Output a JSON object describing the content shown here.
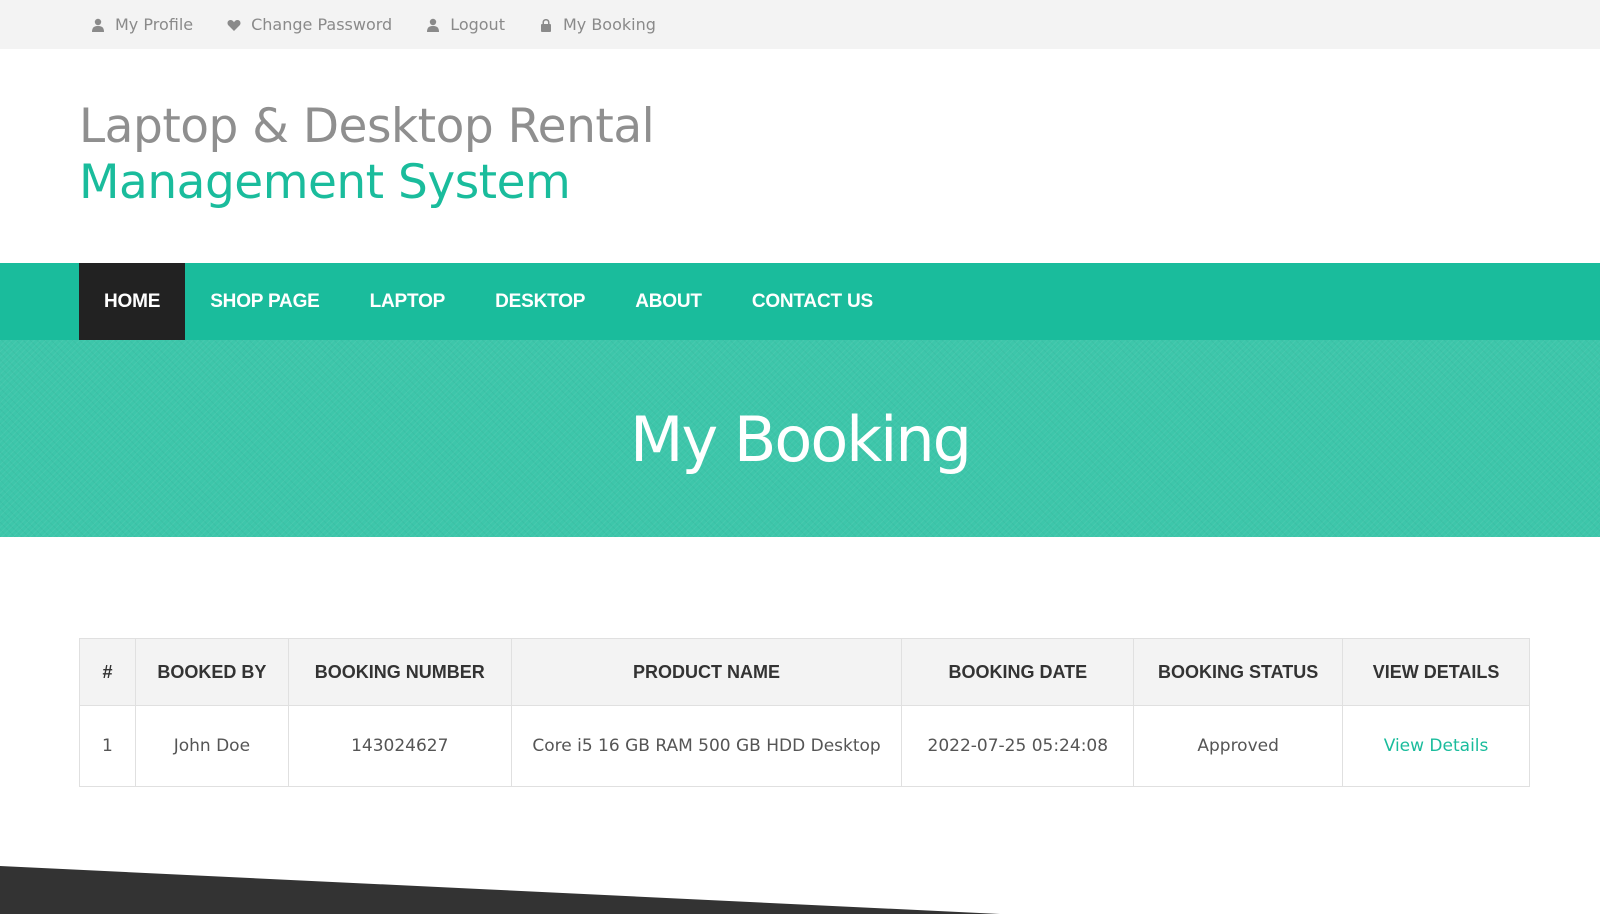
{
  "topbar": {
    "links": [
      {
        "label": "My Profile",
        "icon": "user-icon"
      },
      {
        "label": "Change Password",
        "icon": "heart-icon"
      },
      {
        "label": "Logout",
        "icon": "user-icon"
      },
      {
        "label": "My Booking",
        "icon": "lock-icon"
      }
    ]
  },
  "header": {
    "title_line1": "Laptop & Desktop Rental",
    "title_line2": "Management System"
  },
  "nav": {
    "items": [
      "HOME",
      "SHOP PAGE",
      "LAPTOP",
      "DESKTOP",
      "ABOUT",
      "CONTACT US"
    ],
    "active": "HOME"
  },
  "banner": {
    "title": "My Booking"
  },
  "table": {
    "headers": [
      "#",
      "BOOKED BY",
      "BOOKING NUMBER",
      "PRODUCT NAME",
      "BOOKING DATE",
      "BOOKING STATUS",
      "VIEW DETAILS"
    ],
    "rows": [
      {
        "index": "1",
        "booked_by": "John Doe",
        "booking_number": "143024627",
        "product_name": "Core i5 16 GB RAM 500 GB HDD Desktop",
        "booking_date": "2022-07-25 05:24:08",
        "status": "Approved",
        "details_link": "View Details"
      }
    ]
  },
  "colors": {
    "accent": "#1abc9c",
    "banner": "#3dc6aa",
    "nav_active": "#222222",
    "footer": "#333333"
  }
}
